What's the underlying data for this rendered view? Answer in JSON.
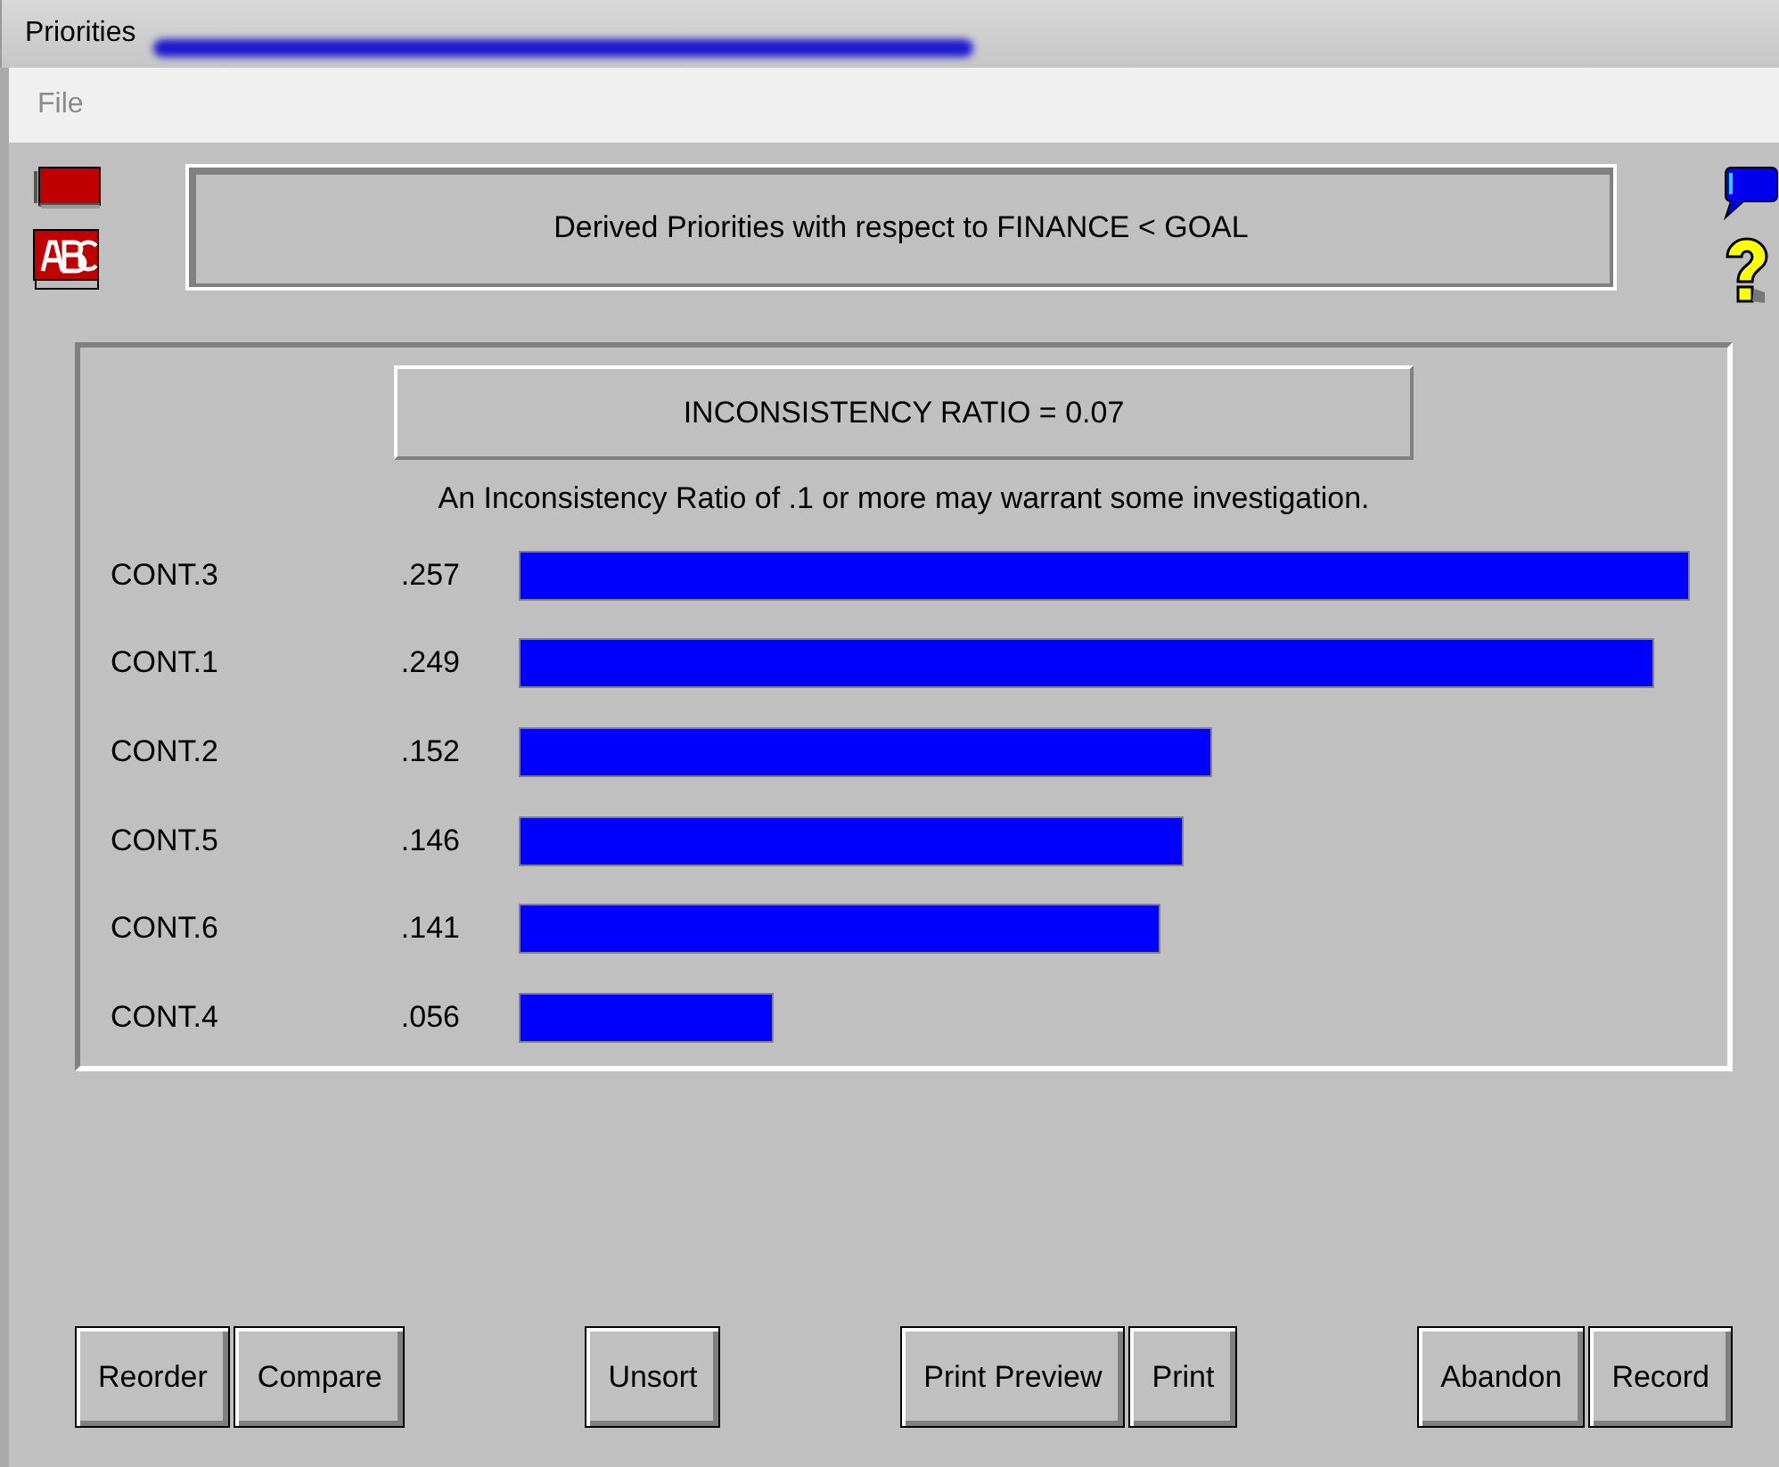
{
  "window": {
    "title": "Priorities"
  },
  "menu": [
    {
      "label": "File",
      "disabled": true
    }
  ],
  "header": {
    "title": "Derived Priorities with respect to FINANCE < GOAL"
  },
  "inconsistency": {
    "label": "INCONSISTENCY RATIO = 0.07",
    "note": "An Inconsistency Ratio of .1 or more may warrant some investigation."
  },
  "priorities": [
    {
      "name": "CONT.3",
      "value": ".257"
    },
    {
      "name": "CONT.1",
      "value": ".249"
    },
    {
      "name": "CONT.2",
      "value": ".152"
    },
    {
      "name": "CONT.5",
      "value": ".146"
    },
    {
      "name": "CONT.6",
      "value": ".141"
    },
    {
      "name": "CONT.4",
      "value": ".056"
    }
  ],
  "button_groups": [
    [
      "Reorder",
      "Compare"
    ],
    [
      "Unsort"
    ],
    [
      "Print Preview",
      "Print"
    ],
    [
      "Abandon",
      "Record"
    ]
  ]
}
